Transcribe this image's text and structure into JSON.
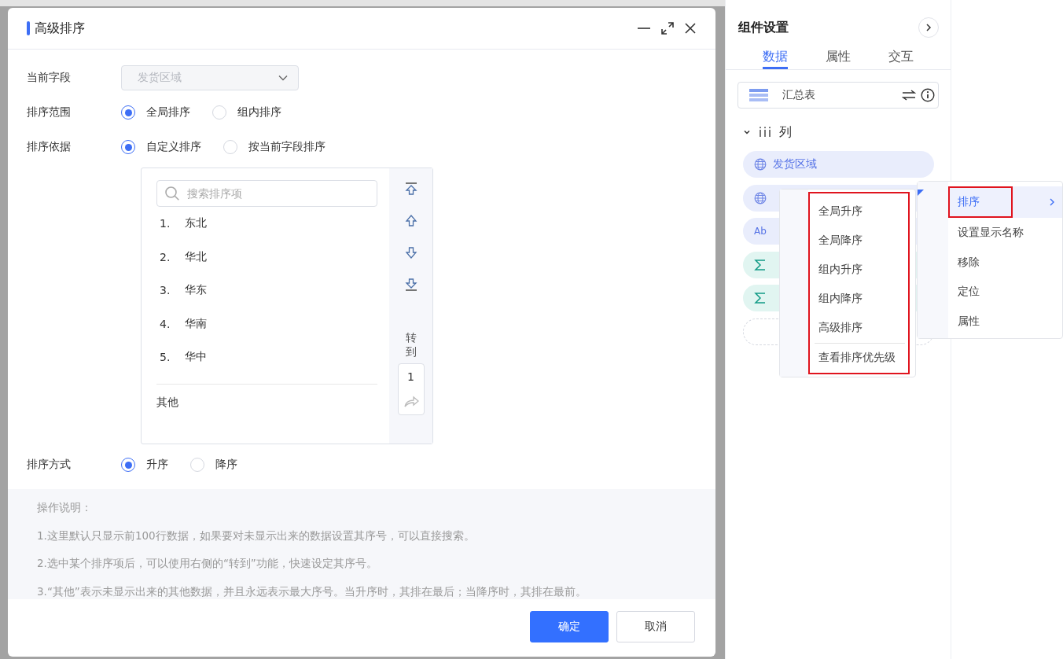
{
  "dialog": {
    "title": "高级排序",
    "fields": [
      {
        "label": "当前字段",
        "kind": "select",
        "value": "发货区域",
        "disabled": true
      },
      {
        "label": "排序范围",
        "kind": "radio",
        "options": [
          {
            "label": "全局排序",
            "selected": true
          },
          {
            "label": "组内排序",
            "selected": false
          }
        ]
      },
      {
        "label": "排序依据",
        "kind": "radio",
        "options": [
          {
            "label": "自定义排序",
            "selected": true
          },
          {
            "label": "按当前字段排序",
            "selected": false
          }
        ]
      }
    ],
    "sort_list": {
      "search_placeholder": "搜索排序项",
      "items": [
        {
          "index": "1.",
          "name": "东北"
        },
        {
          "index": "2.",
          "name": "华北"
        },
        {
          "index": "3.",
          "name": "华东"
        },
        {
          "index": "4.",
          "name": "华南"
        },
        {
          "index": "5.",
          "name": "华中"
        }
      ],
      "other": "其他",
      "goto_label": "转到",
      "goto_value": "1"
    },
    "order": {
      "label": "排序方式",
      "options": [
        {
          "label": "升序",
          "selected": true
        },
        {
          "label": "降序",
          "selected": false
        }
      ]
    },
    "notes": [
      "操作说明：",
      "1.这里默认只显示前100行数据，如果要对未显示出来的数据设置其序号，可以直接搜索。",
      "2.选中某个排序项后，可以使用右侧的“转到”功能，快速设定其序号。",
      "3.“其他”表示未显示出来的其他数据，并且永远表示最大序号。当升序时，其排在最后；当降序时，其排在最前。"
    ],
    "buttons": [
      {
        "label": "确定",
        "kind": "primary"
      },
      {
        "label": "取消",
        "kind": "default"
      }
    ]
  },
  "panel": {
    "title": "组件设置",
    "tabs": [
      {
        "label": "数据",
        "selected": true
      },
      {
        "label": "属性",
        "selected": false
      },
      {
        "label": "交互",
        "selected": false
      }
    ],
    "dataset": "汇总表",
    "group": {
      "label": "列",
      "expanded": true,
      "fields": [
        {
          "kind": "dimension",
          "name": "发货区域"
        },
        {
          "kind": "dimension"
        },
        {
          "kind": "text",
          "icon_text": "Ab"
        },
        {
          "kind": "measure"
        },
        {
          "kind": "measure"
        }
      ]
    }
  },
  "context_menu": {
    "items": [
      {
        "label": "排序",
        "selected": true,
        "annotated": true,
        "submenu": true
      },
      {
        "label": "设置显示名称",
        "selected": false,
        "annotated": false
      },
      {
        "label": "移除",
        "selected": false,
        "annotated": false
      },
      {
        "label": "定位",
        "selected": false,
        "annotated": false
      },
      {
        "label": "属性",
        "selected": false,
        "annotated": false
      }
    ]
  },
  "submenu": {
    "annotated": true,
    "items": [
      "全局升序",
      "全局降序",
      "组内升序",
      "组内降序",
      "高级排序"
    ],
    "footer_item": "查看排序优先级"
  }
}
